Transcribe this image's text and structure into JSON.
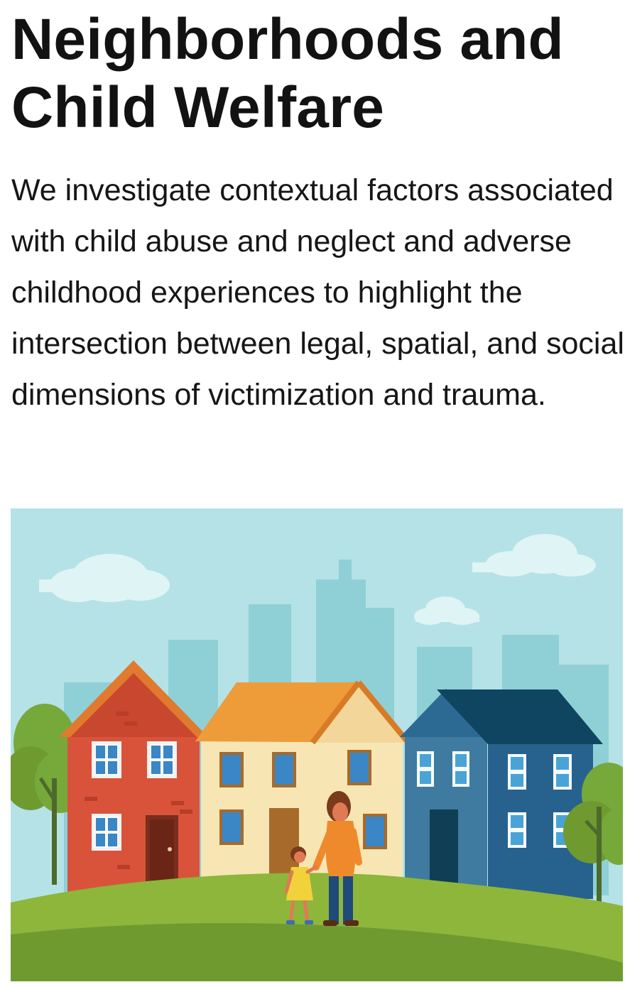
{
  "section": {
    "title": "Neighborhoods and Child Welfare",
    "description": "We investigate contextual factors associated with child abuse and neglect and adverse childhood experiences to highlight the intersection between legal, spatial, and social dimensions of victimization and trauma."
  },
  "illustration": {
    "subject": "neighborhood-houses-with-parent-and-child",
    "colors": {
      "sky": "#b5e2e6",
      "skyline": "#8fd0d6",
      "cloud": "#dff4f5",
      "grass": "#8db63b",
      "grass_dark": "#6f9a30",
      "red_house": "#d9533b",
      "cream_house": "#f7e6b4",
      "orange_roof": "#ee9b3a",
      "blue_house": "#3f7ba0",
      "navy_house": "#27628e",
      "navy_roof": "#0f4561",
      "tree": "#77a83a"
    }
  }
}
